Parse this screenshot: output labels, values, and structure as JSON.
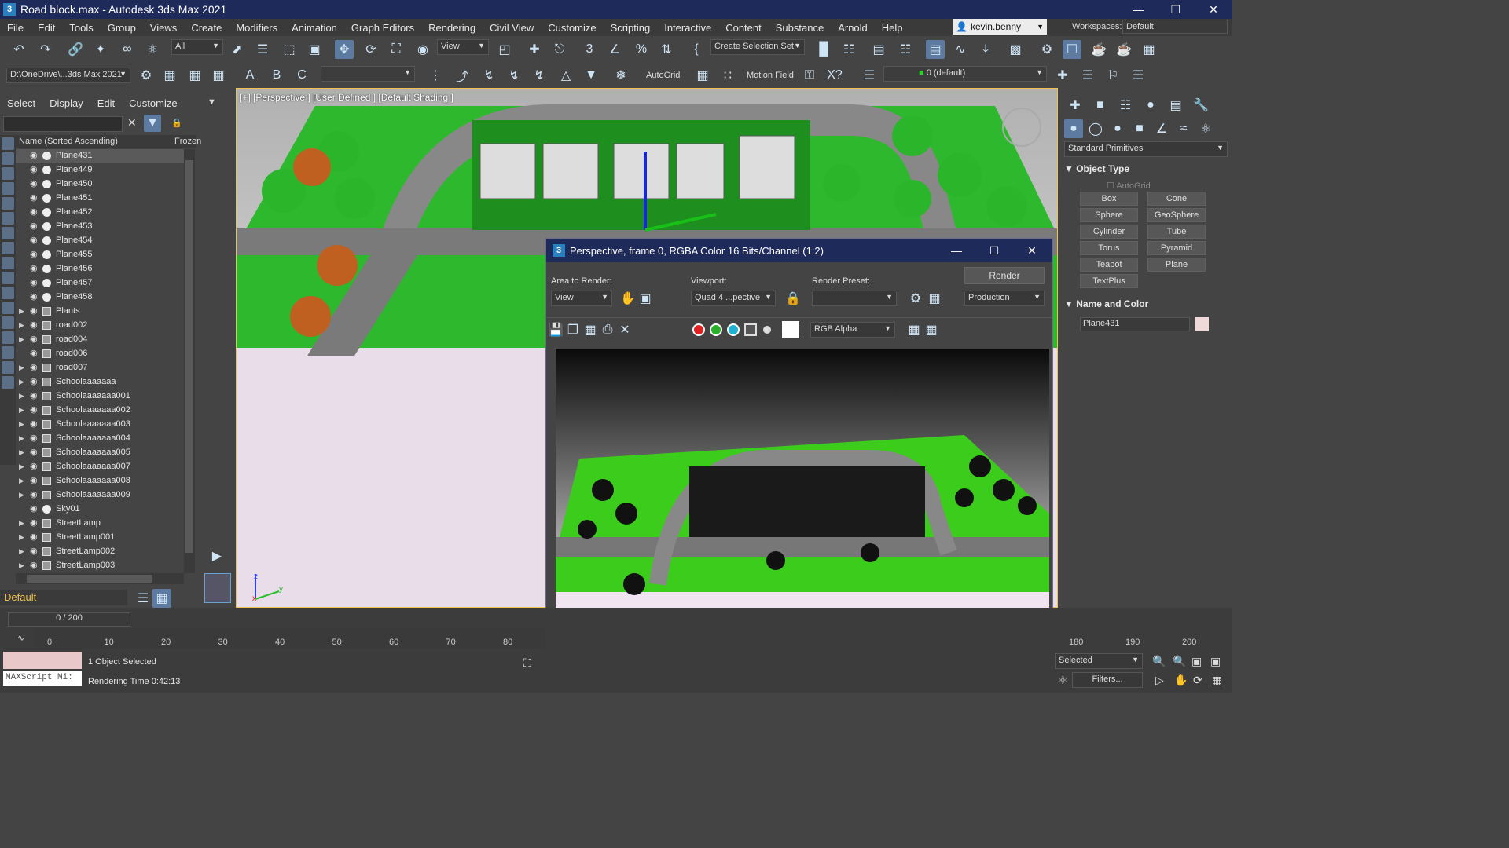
{
  "window": {
    "title": "Road block.max - Autodesk 3ds Max 2021",
    "icon": "3"
  },
  "menu": [
    "File",
    "Edit",
    "Tools",
    "Group",
    "Views",
    "Create",
    "Modifiers",
    "Animation",
    "Graph Editors",
    "Rendering",
    "Civil View",
    "Customize",
    "Scripting",
    "Interactive",
    "Content",
    "Substance",
    "Arnold",
    "Help"
  ],
  "user": {
    "name": "kevin.benny"
  },
  "workspace": {
    "label": "Workspaces:",
    "value": "Default"
  },
  "toolbar": {
    "filter": "All",
    "ref_coord": "View",
    "selection_set": "Create Selection Set",
    "project_path": "D:\\OneDrive\\...3ds Max 2021",
    "autogrid": "AutoGrid",
    "motion_field": "Motion Field",
    "layer": "0 (default)"
  },
  "scene_explorer": {
    "menu": [
      "Select",
      "Display",
      "Edit",
      "Customize"
    ],
    "col_name": "Name (Sorted Ascending)",
    "col_frozen": "Frozen",
    "items": [
      {
        "name": "Plane431",
        "kind": "sphere",
        "expand": false,
        "selected": true
      },
      {
        "name": "Plane449",
        "kind": "sphere",
        "expand": false
      },
      {
        "name": "Plane450",
        "kind": "sphere",
        "expand": false
      },
      {
        "name": "Plane451",
        "kind": "sphere",
        "expand": false
      },
      {
        "name": "Plane452",
        "kind": "sphere",
        "expand": false
      },
      {
        "name": "Plane453",
        "kind": "sphere",
        "expand": false
      },
      {
        "name": "Plane454",
        "kind": "sphere",
        "expand": false
      },
      {
        "name": "Plane455",
        "kind": "sphere",
        "expand": false
      },
      {
        "name": "Plane456",
        "kind": "sphere",
        "expand": false
      },
      {
        "name": "Plane457",
        "kind": "sphere",
        "expand": false
      },
      {
        "name": "Plane458",
        "kind": "sphere",
        "expand": false
      },
      {
        "name": "Plants",
        "kind": "group",
        "expand": true
      },
      {
        "name": "road002",
        "kind": "group",
        "expand": true
      },
      {
        "name": "road004",
        "kind": "group",
        "expand": true
      },
      {
        "name": "road006",
        "kind": "group",
        "expand": false
      },
      {
        "name": "road007",
        "kind": "group",
        "expand": true
      },
      {
        "name": "Schoolaaaaaaa",
        "kind": "group",
        "expand": true
      },
      {
        "name": "Schoolaaaaaaa001",
        "kind": "group",
        "expand": true
      },
      {
        "name": "Schoolaaaaaaa002",
        "kind": "group",
        "expand": true
      },
      {
        "name": "Schoolaaaaaaa003",
        "kind": "group",
        "expand": true
      },
      {
        "name": "Schoolaaaaaaa004",
        "kind": "group",
        "expand": true
      },
      {
        "name": "Schoolaaaaaaa005",
        "kind": "group",
        "expand": true
      },
      {
        "name": "Schoolaaaaaaa007",
        "kind": "group",
        "expand": true
      },
      {
        "name": "Schoolaaaaaaa008",
        "kind": "group",
        "expand": true
      },
      {
        "name": "Schoolaaaaaaa009",
        "kind": "group",
        "expand": true
      },
      {
        "name": "Sky01",
        "kind": "light",
        "expand": false
      },
      {
        "name": "StreetLamp",
        "kind": "group",
        "expand": true
      },
      {
        "name": "StreetLamp001",
        "kind": "group",
        "expand": true
      },
      {
        "name": "StreetLamp002",
        "kind": "group",
        "expand": true
      },
      {
        "name": "StreetLamp003",
        "kind": "group",
        "expand": true
      }
    ],
    "layer_dropdown": "Default"
  },
  "viewport": {
    "label": "[+] [Perspective ] [User Defined ] [Default Shading ]"
  },
  "render_window": {
    "title": "Perspective, frame 0, RGBA Color 16 Bits/Channel (1:2)",
    "area_label": "Area to Render:",
    "area_value": "View",
    "viewport_label": "Viewport:",
    "viewport_value": "Quad 4 ...pective",
    "preset_label": "Render Preset:",
    "preset_value": "",
    "render_button": "Render",
    "production": "Production",
    "channel": "RGB Alpha"
  },
  "command_panel": {
    "category": "Standard Primitives",
    "object_type": "Object Type",
    "autogrid": "AutoGrid",
    "primitives": [
      "Box",
      "Cone",
      "Sphere",
      "GeoSphere",
      "Cylinder",
      "Tube",
      "Torus",
      "Pyramid",
      "Teapot",
      "Plane",
      "TextPlus"
    ],
    "name_color": "Name and Color",
    "object_name": "Plane431"
  },
  "timeline": {
    "frame": "0 / 200",
    "ticks": [
      "0",
      "10",
      "20",
      "30",
      "40",
      "50",
      "60",
      "70",
      "80"
    ],
    "ticks_right": [
      "180",
      "190",
      "200"
    ]
  },
  "status": {
    "selected": "1 Object Selected",
    "render_time": "Rendering Time  0:42:13",
    "maxscript": "MAXScript Mi:",
    "selection_filter": "Selected",
    "filters": "Filters..."
  }
}
